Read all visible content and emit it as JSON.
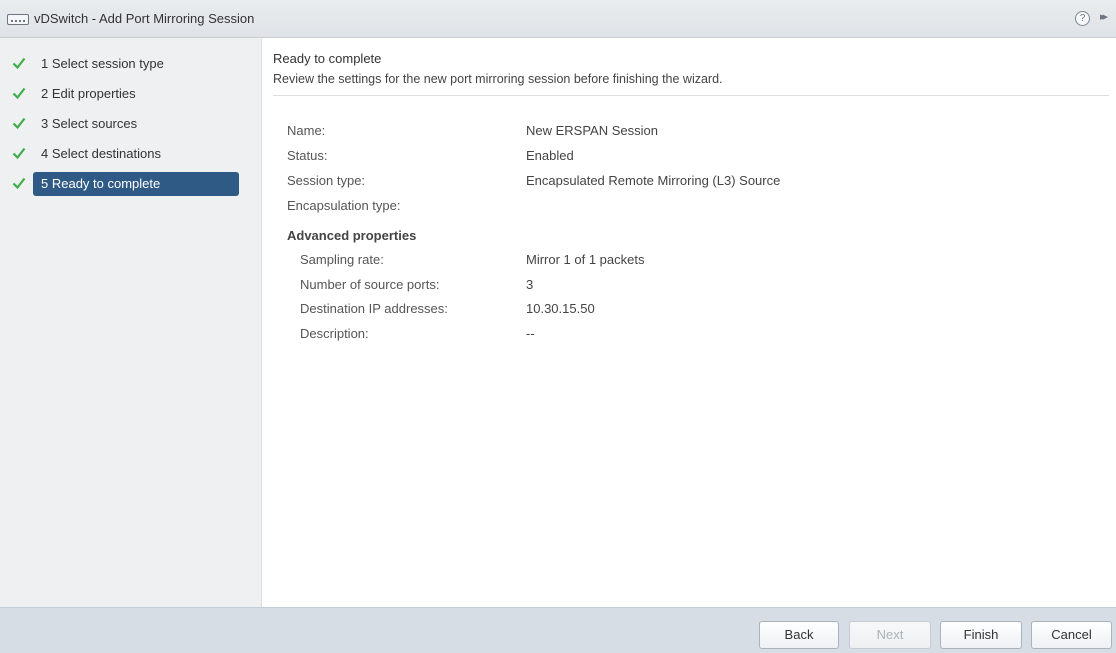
{
  "window": {
    "title": "vDSwitch - Add Port Mirroring Session",
    "help_symbol": "?",
    "expand_symbol": "▸▸"
  },
  "steps": [
    {
      "label": "1  Select session type",
      "completed": true,
      "active": false
    },
    {
      "label": "2  Edit properties",
      "completed": true,
      "active": false
    },
    {
      "label": "3  Select sources",
      "completed": true,
      "active": false
    },
    {
      "label": "4  Select destinations",
      "completed": true,
      "active": false
    },
    {
      "label": "5  Ready to complete",
      "completed": true,
      "active": true
    }
  ],
  "main": {
    "heading": "Ready to complete",
    "subheading": "Review the settings for the new port mirroring session before finishing the wizard.",
    "summary": [
      {
        "label": "Name:",
        "value": "New ERSPAN Session"
      },
      {
        "label": "Status:",
        "value": "Enabled"
      },
      {
        "label": "Session type:",
        "value": "Encapsulated Remote Mirroring (L3) Source"
      },
      {
        "label": "Encapsulation type:",
        "value": ""
      }
    ],
    "advanced_title": "Advanced properties",
    "advanced": [
      {
        "label": "Sampling rate:",
        "value": "Mirror 1 of 1 packets"
      },
      {
        "label": "Number of source ports:",
        "value": "3"
      },
      {
        "label": "Destination IP addresses:",
        "value": "10.30.15.50"
      },
      {
        "label": "Description:",
        "value": "--"
      }
    ]
  },
  "footer": {
    "back": "Back",
    "next": "Next",
    "finish": "Finish",
    "cancel": "Cancel"
  },
  "colors": {
    "check": "#3fae49",
    "active_step": "#2f5a85"
  }
}
